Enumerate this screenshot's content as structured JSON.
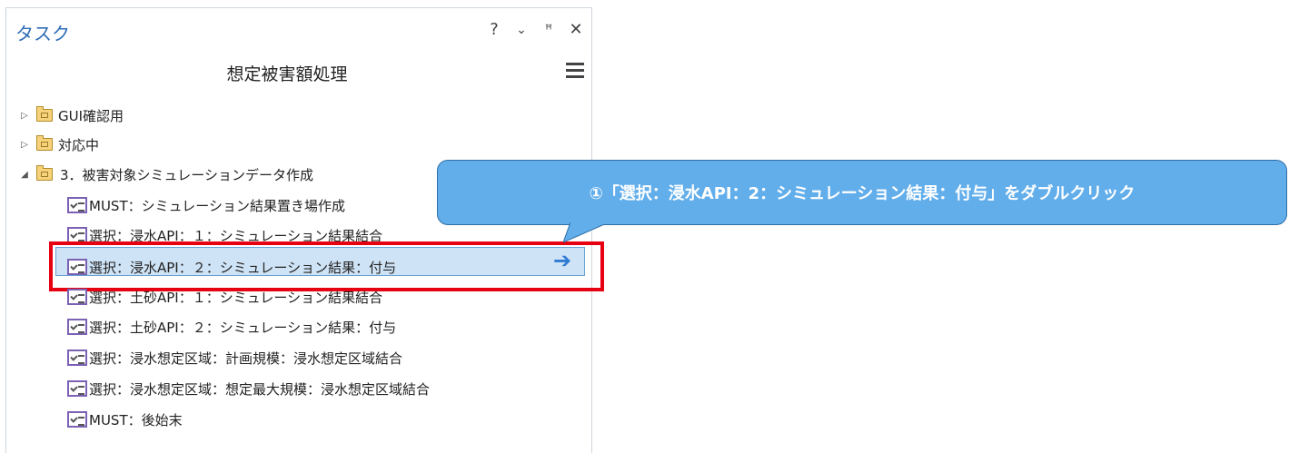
{
  "pane": {
    "title": "タスク",
    "controls": {
      "help": "?",
      "dropdown": "⌄",
      "pin": "📌",
      "close": "✕"
    },
    "heading": "想定被害額処理"
  },
  "tree": {
    "folders": [
      {
        "label": "GUI確認用",
        "expanded": false
      },
      {
        "label": "対応中",
        "expanded": false
      },
      {
        "label": "3．被害対象シミュレーションデータ作成",
        "expanded": true
      }
    ],
    "tasks": [
      {
        "label": "MUST：シミュレーション結果置き場作成"
      },
      {
        "label": "選択：浸水API：１：シミュレーション結果結合"
      },
      {
        "label": "選択：浸水API：２：シミュレーション結果：付与",
        "selected": true
      },
      {
        "label": "選択：土砂API：１：シミュレーション結果結合"
      },
      {
        "label": "選択：土砂API：２：シミュレーション結果：付与"
      },
      {
        "label": "選択：浸水想定区域：計画規模：浸水想定区域結合"
      },
      {
        "label": "選択：浸水想定区域：想定最大規模：浸水想定区域結合"
      },
      {
        "label": "MUST：後始末"
      }
    ]
  },
  "callout": {
    "text": "①「選択：浸水API：2：シミュレーション結果：付与」をダブルクリック"
  },
  "colors": {
    "accent": "#2f6db5",
    "callout_fill": "#62aeeb",
    "highlight_border": "#e60012",
    "selection_fill": "#cfe3f6",
    "task_icon": "#7b61b3",
    "arrow": "#2f7bd3"
  }
}
